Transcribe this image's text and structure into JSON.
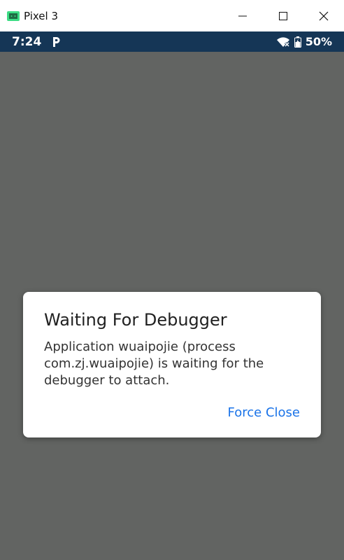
{
  "window": {
    "title": "Pixel 3",
    "app_icon": "android-emulator-icon",
    "controls": [
      "minimize-icon",
      "maximize-icon",
      "close-icon"
    ]
  },
  "status_bar": {
    "time": "7:24",
    "notification_icon": "parking-p-icon",
    "wifi_icon": "wifi-no-internet-icon",
    "battery_icon": "battery-charging-icon",
    "battery_level": "50%",
    "background_color": "#153656"
  },
  "dialog": {
    "title": "Waiting For Debugger",
    "message_lines": [
      "Application wuaipojie (process",
      "com.zj.wuaipojie) is waiting for the",
      "debugger to attach."
    ],
    "button_label": "Force Close",
    "accent_color": "#1a73e8"
  }
}
